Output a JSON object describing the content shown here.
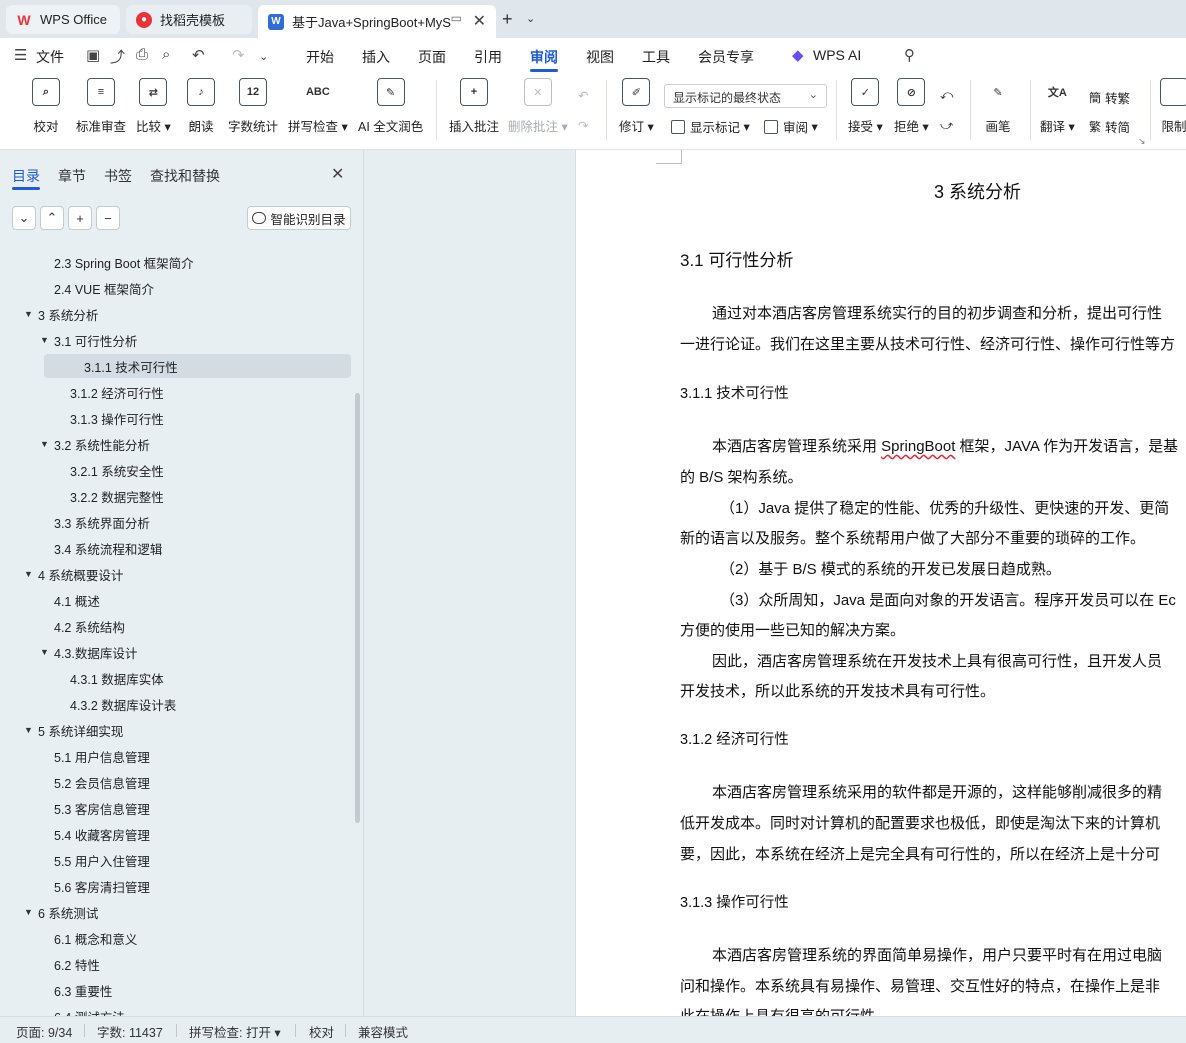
{
  "tabs": {
    "wps": "WPS Office",
    "daoke": "找稻壳模板",
    "doc": "基于Java+SpringBoot+MyS"
  },
  "menu": {
    "file": "文件",
    "items": [
      "开始",
      "插入",
      "页面",
      "引用",
      "审阅",
      "视图",
      "工具",
      "会员专享"
    ],
    "active": "审阅",
    "wps_ai": "WPS AI"
  },
  "ribbon": {
    "proofread": "校对",
    "standard_review": "标准审查",
    "compare": "比较",
    "read_aloud": "朗读",
    "word_count": "字数统计",
    "spell_check": "拼写检查",
    "ai_polish": "AI 全文润色",
    "insert_comment": "插入批注",
    "delete_comment": "删除批注",
    "track_changes": "修订",
    "markup_mode": "显示标记的最终状态",
    "show_markup": "显示标记",
    "review_pane": "审阅",
    "accept": "接受",
    "reject": "拒绝",
    "pen": "画笔",
    "translate": "翻译",
    "to_traditional": "转繁",
    "to_simplified": "转简",
    "restrict": "限制",
    "word_count_icon_text": "12",
    "spell_icon_text": "ABC"
  },
  "nav": {
    "tabs": [
      "目录",
      "章节",
      "书签",
      "查找和替换"
    ],
    "smart_toc": "智能识别目录",
    "toc": [
      {
        "label": "2.3 Spring Boot 框架简介",
        "level": 2,
        "caret": ""
      },
      {
        "label": "2.4 VUE 框架简介",
        "level": 2,
        "caret": ""
      },
      {
        "label": "3 系统分析",
        "level": 1,
        "caret": "▼"
      },
      {
        "label": "3.1 可行性分析",
        "level": 2,
        "caret": "▼"
      },
      {
        "label": "3.1.1 技术可行性",
        "level": 3,
        "caret": "",
        "selected": true
      },
      {
        "label": "3.1.2 经济可行性",
        "level": 3,
        "caret": ""
      },
      {
        "label": "3.1.3 操作可行性",
        "level": 3,
        "caret": ""
      },
      {
        "label": "3.2 系统性能分析",
        "level": 2,
        "caret": "▼"
      },
      {
        "label": "3.2.1  系统安全性",
        "level": 3,
        "caret": ""
      },
      {
        "label": "3.2.2  数据完整性",
        "level": 3,
        "caret": ""
      },
      {
        "label": "3.3 系统界面分析",
        "level": 2,
        "caret": ""
      },
      {
        "label": "3.4 系统流程和逻辑",
        "level": 2,
        "caret": ""
      },
      {
        "label": "4 系统概要设计",
        "level": 1,
        "caret": "▼"
      },
      {
        "label": "4.1 概述",
        "level": 2,
        "caret": ""
      },
      {
        "label": "4.2 系统结构",
        "level": 2,
        "caret": ""
      },
      {
        "label": "4.3.数据库设计",
        "level": 2,
        "caret": "▼"
      },
      {
        "label": "4.3.1 数据库实体",
        "level": 3,
        "caret": ""
      },
      {
        "label": "4.3.2 数据库设计表",
        "level": 3,
        "caret": ""
      },
      {
        "label": "5 系统详细实现",
        "level": 1,
        "caret": "▼"
      },
      {
        "label": "5.1  用户信息管理",
        "level": 2,
        "caret": ""
      },
      {
        "label": "5.2  会员信息管理",
        "level": 2,
        "caret": ""
      },
      {
        "label": "5.3  客房信息管理",
        "level": 2,
        "caret": ""
      },
      {
        "label": "5.4  收藏客房管理",
        "level": 2,
        "caret": ""
      },
      {
        "label": "5.5  用户入住管理",
        "level": 2,
        "caret": ""
      },
      {
        "label": "5.6  客房清扫管理",
        "level": 2,
        "caret": ""
      },
      {
        "label": "6 系统测试",
        "level": 1,
        "caret": "▼"
      },
      {
        "label": "6.1 概念和意义",
        "level": 2,
        "caret": ""
      },
      {
        "label": "6.2 特性",
        "level": 2,
        "caret": ""
      },
      {
        "label": "6.3 重要性",
        "level": 2,
        "caret": ""
      },
      {
        "label": "6.4 测试方法",
        "level": 2,
        "caret": ""
      }
    ]
  },
  "doc": {
    "h1": "3 系统分析",
    "h2": "3.1 可行性分析",
    "p_intro_1": "通过对本酒店客房管理系统实行的目的初步调查和分析，提出可行性",
    "p_intro_2": "一进行论证。我们在这里主要从技术可行性、经济可行性、操作可行性等方",
    "h3_tech": "3.1.1 技术可行性",
    "p_tech_1a": "本酒店客房管理系统采用 ",
    "p_tech_1b": "SpringBoot",
    "p_tech_1c": " 框架，JAVA 作为开发语言，是基",
    "p_tech_2": "的 B/S 架构系统。",
    "p_tech_3": "（1）Java 提供了稳定的性能、优秀的升级性、更快速的开发、更简",
    "p_tech_4": "新的语言以及服务。整个系统帮用户做了大部分不重要的琐碎的工作。",
    "p_tech_5": "（2）基于 B/S 模式的系统的开发已发展日趋成熟。",
    "p_tech_6": "（3）众所周知，Java 是面向对象的开发语言。程序开发员可以在 Ec",
    "p_tech_7": "方便的使用一些已知的解决方案。",
    "p_tech_8": "因此，酒店客房管理系统在开发技术上具有很高可行性，且开发人员",
    "p_tech_9": "开发技术，所以此系统的开发技术具有可行性。",
    "h3_econ": "3.1.2 经济可行性",
    "p_econ_1": "本酒店客房管理系统采用的软件都是开源的，这样能够削减很多的精",
    "p_econ_2": "低开发成本。同时对计算机的配置要求也极低，即使是淘汰下来的计算机",
    "p_econ_3": "要，因此，本系统在经济上是完全具有可行性的，所以在经济上是十分可",
    "h3_oper": "3.1.3 操作可行性",
    "p_oper_1": "本酒店客房管理系统的界面简单易操作，用户只要平时有在用过电脑",
    "p_oper_2": "问和操作。本系统具有易操作、易管理、交互性好的特点，在操作上是非",
    "p_oper_3": "此在操作上具有很高的可行性。"
  },
  "status": {
    "page": "页面: 9/34",
    "words": "字数: 11437",
    "spell": "拼写检查: 打开",
    "proof": "校对",
    "compat": "兼容模式"
  },
  "colors": {
    "accent": "#1e5bd6",
    "panel_bg": "#e8eff3",
    "selected_bg": "#d3dce2"
  }
}
